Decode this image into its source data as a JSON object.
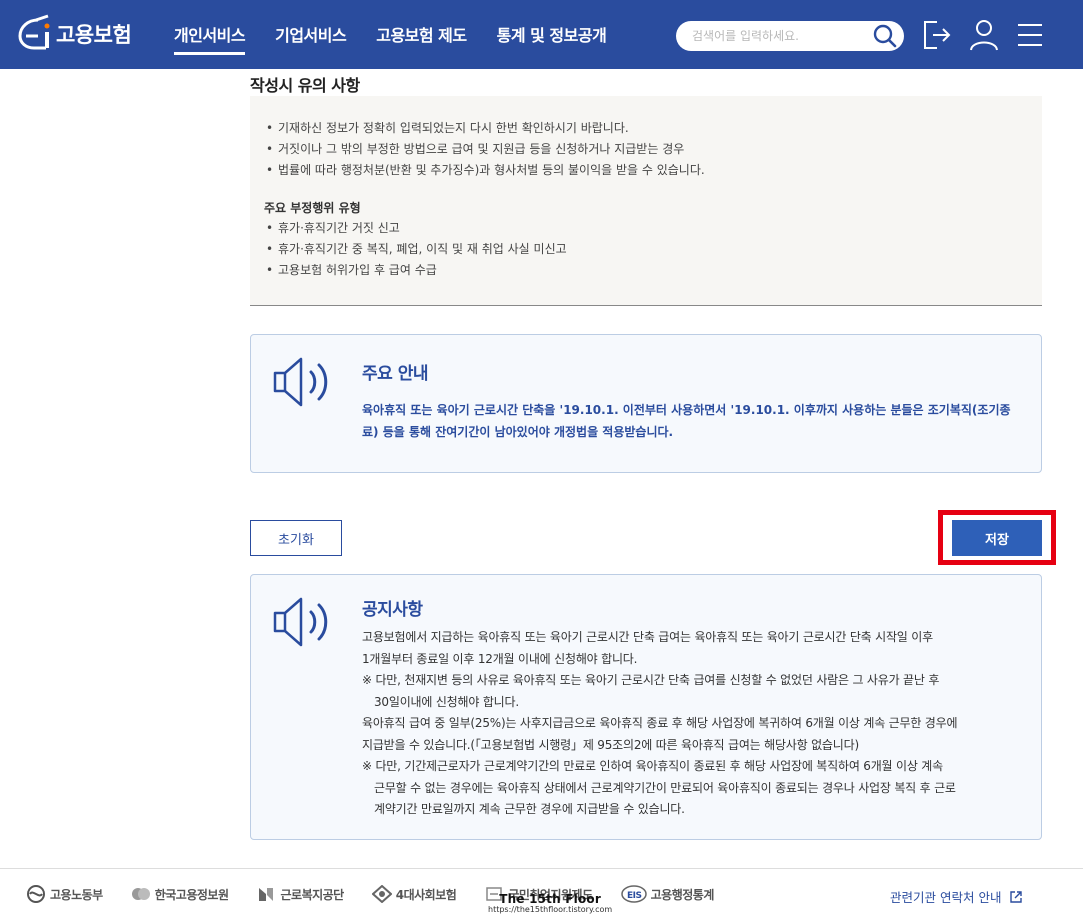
{
  "header": {
    "logo_text": "고용보험",
    "nav": [
      "개인서비스",
      "기업서비스",
      "고용보험 제도",
      "통계 및 정보공개"
    ],
    "active_nav": "개인서비스",
    "search_placeholder": "검색어를 입력하세요."
  },
  "notice": {
    "title": "작성시 유의 사항",
    "items": [
      "기재하신 정보가 정확히 입력되었는지 다시 한번 확인하시기 바랍니다.",
      "거짓이나 그 밖의 부정한 방법으로 급여 및 지원급 등을 신청하거나 지급받는 경우",
      "법률에 따라 행정처분(반환 및 추가징수)과 형사처벌 등의 불이익을 받을 수 있습니다."
    ],
    "subtitle": "주요 부정행위 유형",
    "types": [
      "휴가·휴직기간 거짓 신고",
      "휴가·휴직기간 중 복직, 폐업, 이직 및 재 취업 사실 미신고",
      "고용보험 허위가입 후 급여 수급"
    ]
  },
  "main_notice": {
    "title": "주요 안내",
    "text": "육아휴직 또는 육아기 근로시간 단축을 '19.10.1. 이전부터 사용하면서 '19.10.1. 이후까지 사용하는 분들은 조기복직(조기종료) 등을 통해 잔여기간이 남아있어야 개정법을 적용받습니다."
  },
  "buttons": {
    "reset": "초기화",
    "save": "저장"
  },
  "board": {
    "title": "공지사항",
    "lines": [
      "고용보험에서 지급하는 육아휴직 또는 육아기 근로시간 단축 급여는 육아휴직 또는 육아기 근로시간 단축 시작일 이후",
      "1개월부터 종료일 이후 12개월 이내에 신청해야 합니다.",
      "※ 다만, 천재지변 등의 사유로 육아휴직 또는 육아기 근로시간 단축 급여를 신청할 수 없었던 사람은 그 사유가 끝난 후",
      "30일이내에 신청해야 합니다.",
      "육아휴직 급여 중 일부(25%)는 사후지급금으로 육아휴직 종료 후 해당 사업장에 복귀하여 6개월 이상 계속 근무한 경우에",
      "지급받을 수 있습니다.(「고용보험법 시행령」제 95조의2에 따른 육아휴직 급여는 해당사항 없습니다)",
      "※ 다만, 기간제근로자가 근로계약기간의 만료로 인하여 육아휴직이 종료된 후 해당 사업장에 복직하여 6개월 이상 계속",
      "근무할 수 없는 경우에는 육아휴직 상태에서 근로계약기간이 만료되어 육아휴직이 종료되는 경우나 사업장 복직 후 근로",
      "계약기간 만료일까지 계속 근무한 경우에 지급받을 수 있습니다."
    ]
  },
  "footer": {
    "links": [
      "고용노동부",
      "한국고용정보원",
      "근로복지공단",
      "4대사회보험",
      "국민취업지원제도",
      "고용행정통계"
    ],
    "contact": "관련기관 연락처 안내"
  },
  "watermark": {
    "title": "The 15th Floor",
    "url": "https://the15thfloor.tistory.com"
  },
  "colors": {
    "header_bg": "#2a4c9e",
    "primary": "#2a4c9e",
    "save_button": "#2e60b8",
    "highlight": "#e60012"
  }
}
